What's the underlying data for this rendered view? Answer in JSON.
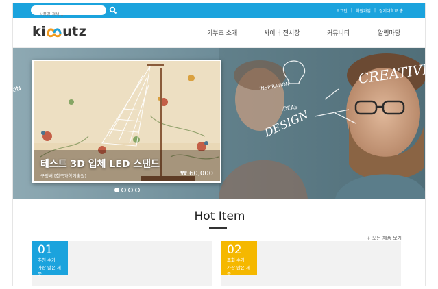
{
  "topbar": {
    "search_placeholder": "상품명 검색...",
    "links": [
      "로그인",
      "회원가입",
      "경기대학교 총"
    ],
    "separator": "|"
  },
  "header": {
    "logo_text_left": "ki",
    "logo_text_right": "utz",
    "nav": [
      "키부츠 소개",
      "사이버 전시장",
      "커뮤니티",
      "알림마당"
    ]
  },
  "hero": {
    "product_title": "테스트 3D 입체 LED 스탠드",
    "product_seller": "구정서 [한국과학기술원]",
    "product_price": "₩ 60,000",
    "bg_words": [
      "CREATIVE",
      "INSPIRATION",
      "IDEAS",
      "DESIGN",
      "KIN"
    ],
    "slides": 4,
    "active_slide": 1
  },
  "hot": {
    "title": "Hot Item",
    "all_link": "+ 모든 제품 보기",
    "items": [
      {
        "rank": "01",
        "caption_1": "추천 수가",
        "caption_2": "가장 많은 제품",
        "color": "#1ba3dd"
      },
      {
        "rank": "02",
        "caption_1": "조회 수가",
        "caption_2": "가장 많은 제품",
        "color": "#f5b800"
      }
    ]
  },
  "colors": {
    "brand_blue": "#1ba3dd",
    "accent_yellow": "#f5b800",
    "logo_blue": "#1ba3dd",
    "logo_orange": "#f29b1d"
  },
  "icons": {
    "search": "search-icon"
  }
}
